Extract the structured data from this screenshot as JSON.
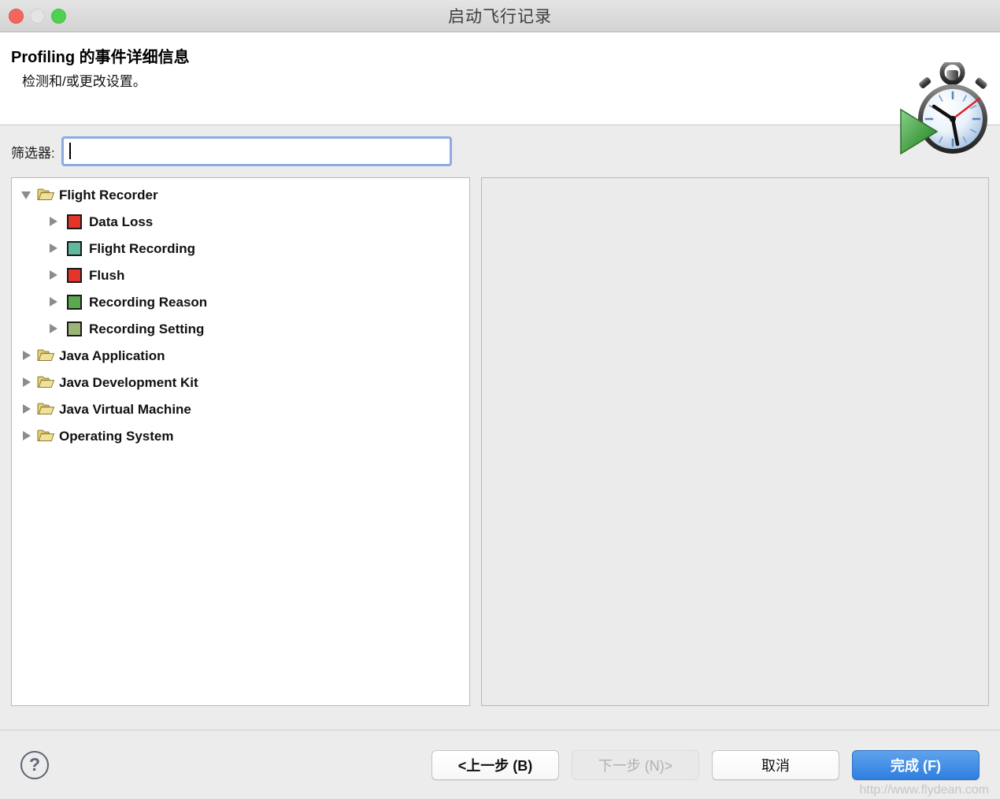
{
  "window": {
    "title": "启动飞行记录",
    "controls": [
      {
        "name": "close",
        "color": "#f1675d"
      },
      {
        "name": "minimize",
        "color": "#e4e4e4"
      },
      {
        "name": "zoom",
        "color": "#4fd14f"
      }
    ]
  },
  "header": {
    "title": "Profiling 的事件详细信息",
    "subtitle": "检测和/或更改设置。",
    "icon": "stopwatch-play-icon"
  },
  "filter": {
    "label": "筛选器:",
    "value": "",
    "placeholder": ""
  },
  "tree": {
    "nodes": [
      {
        "label": "Flight Recorder",
        "icon": "folder-open-icon",
        "twisty": "expanded",
        "level": 0,
        "color": ""
      },
      {
        "label": "Data Loss",
        "icon": "color-swatch",
        "twisty": "collapsed",
        "level": 1,
        "color": "#e5342a"
      },
      {
        "label": "Flight Recording",
        "icon": "color-swatch",
        "twisty": "collapsed",
        "level": 1,
        "color": "#5eb99f"
      },
      {
        "label": "Flush",
        "icon": "color-swatch",
        "twisty": "collapsed",
        "level": 1,
        "color": "#e5342a"
      },
      {
        "label": "Recording Reason",
        "icon": "color-swatch",
        "twisty": "collapsed",
        "level": 1,
        "color": "#5aa94f"
      },
      {
        "label": "Recording Setting",
        "icon": "color-swatch",
        "twisty": "collapsed",
        "level": 1,
        "color": "#9bb577"
      },
      {
        "label": "Java Application",
        "icon": "folder-open-icon",
        "twisty": "collapsed",
        "level": 0,
        "color": ""
      },
      {
        "label": "Java Development Kit",
        "icon": "folder-open-icon",
        "twisty": "collapsed",
        "level": 0,
        "color": ""
      },
      {
        "label": "Java Virtual Machine",
        "icon": "folder-open-icon",
        "twisty": "collapsed",
        "level": 0,
        "color": ""
      },
      {
        "label": "Operating System",
        "icon": "folder-open-icon",
        "twisty": "collapsed",
        "level": 0,
        "color": ""
      }
    ]
  },
  "detail_pane": {
    "content": ""
  },
  "footer": {
    "help_label": "?",
    "buttons": {
      "back": "<上一步 (B)",
      "next": "下一步 (N)>",
      "cancel": "取消",
      "finish": "完成 (F)"
    },
    "watermark": "http://www.flydean.com"
  },
  "colors": {
    "accent": "#2f7fe0",
    "focus_ring": "#8cabe2",
    "window_bg": "#ececec"
  }
}
